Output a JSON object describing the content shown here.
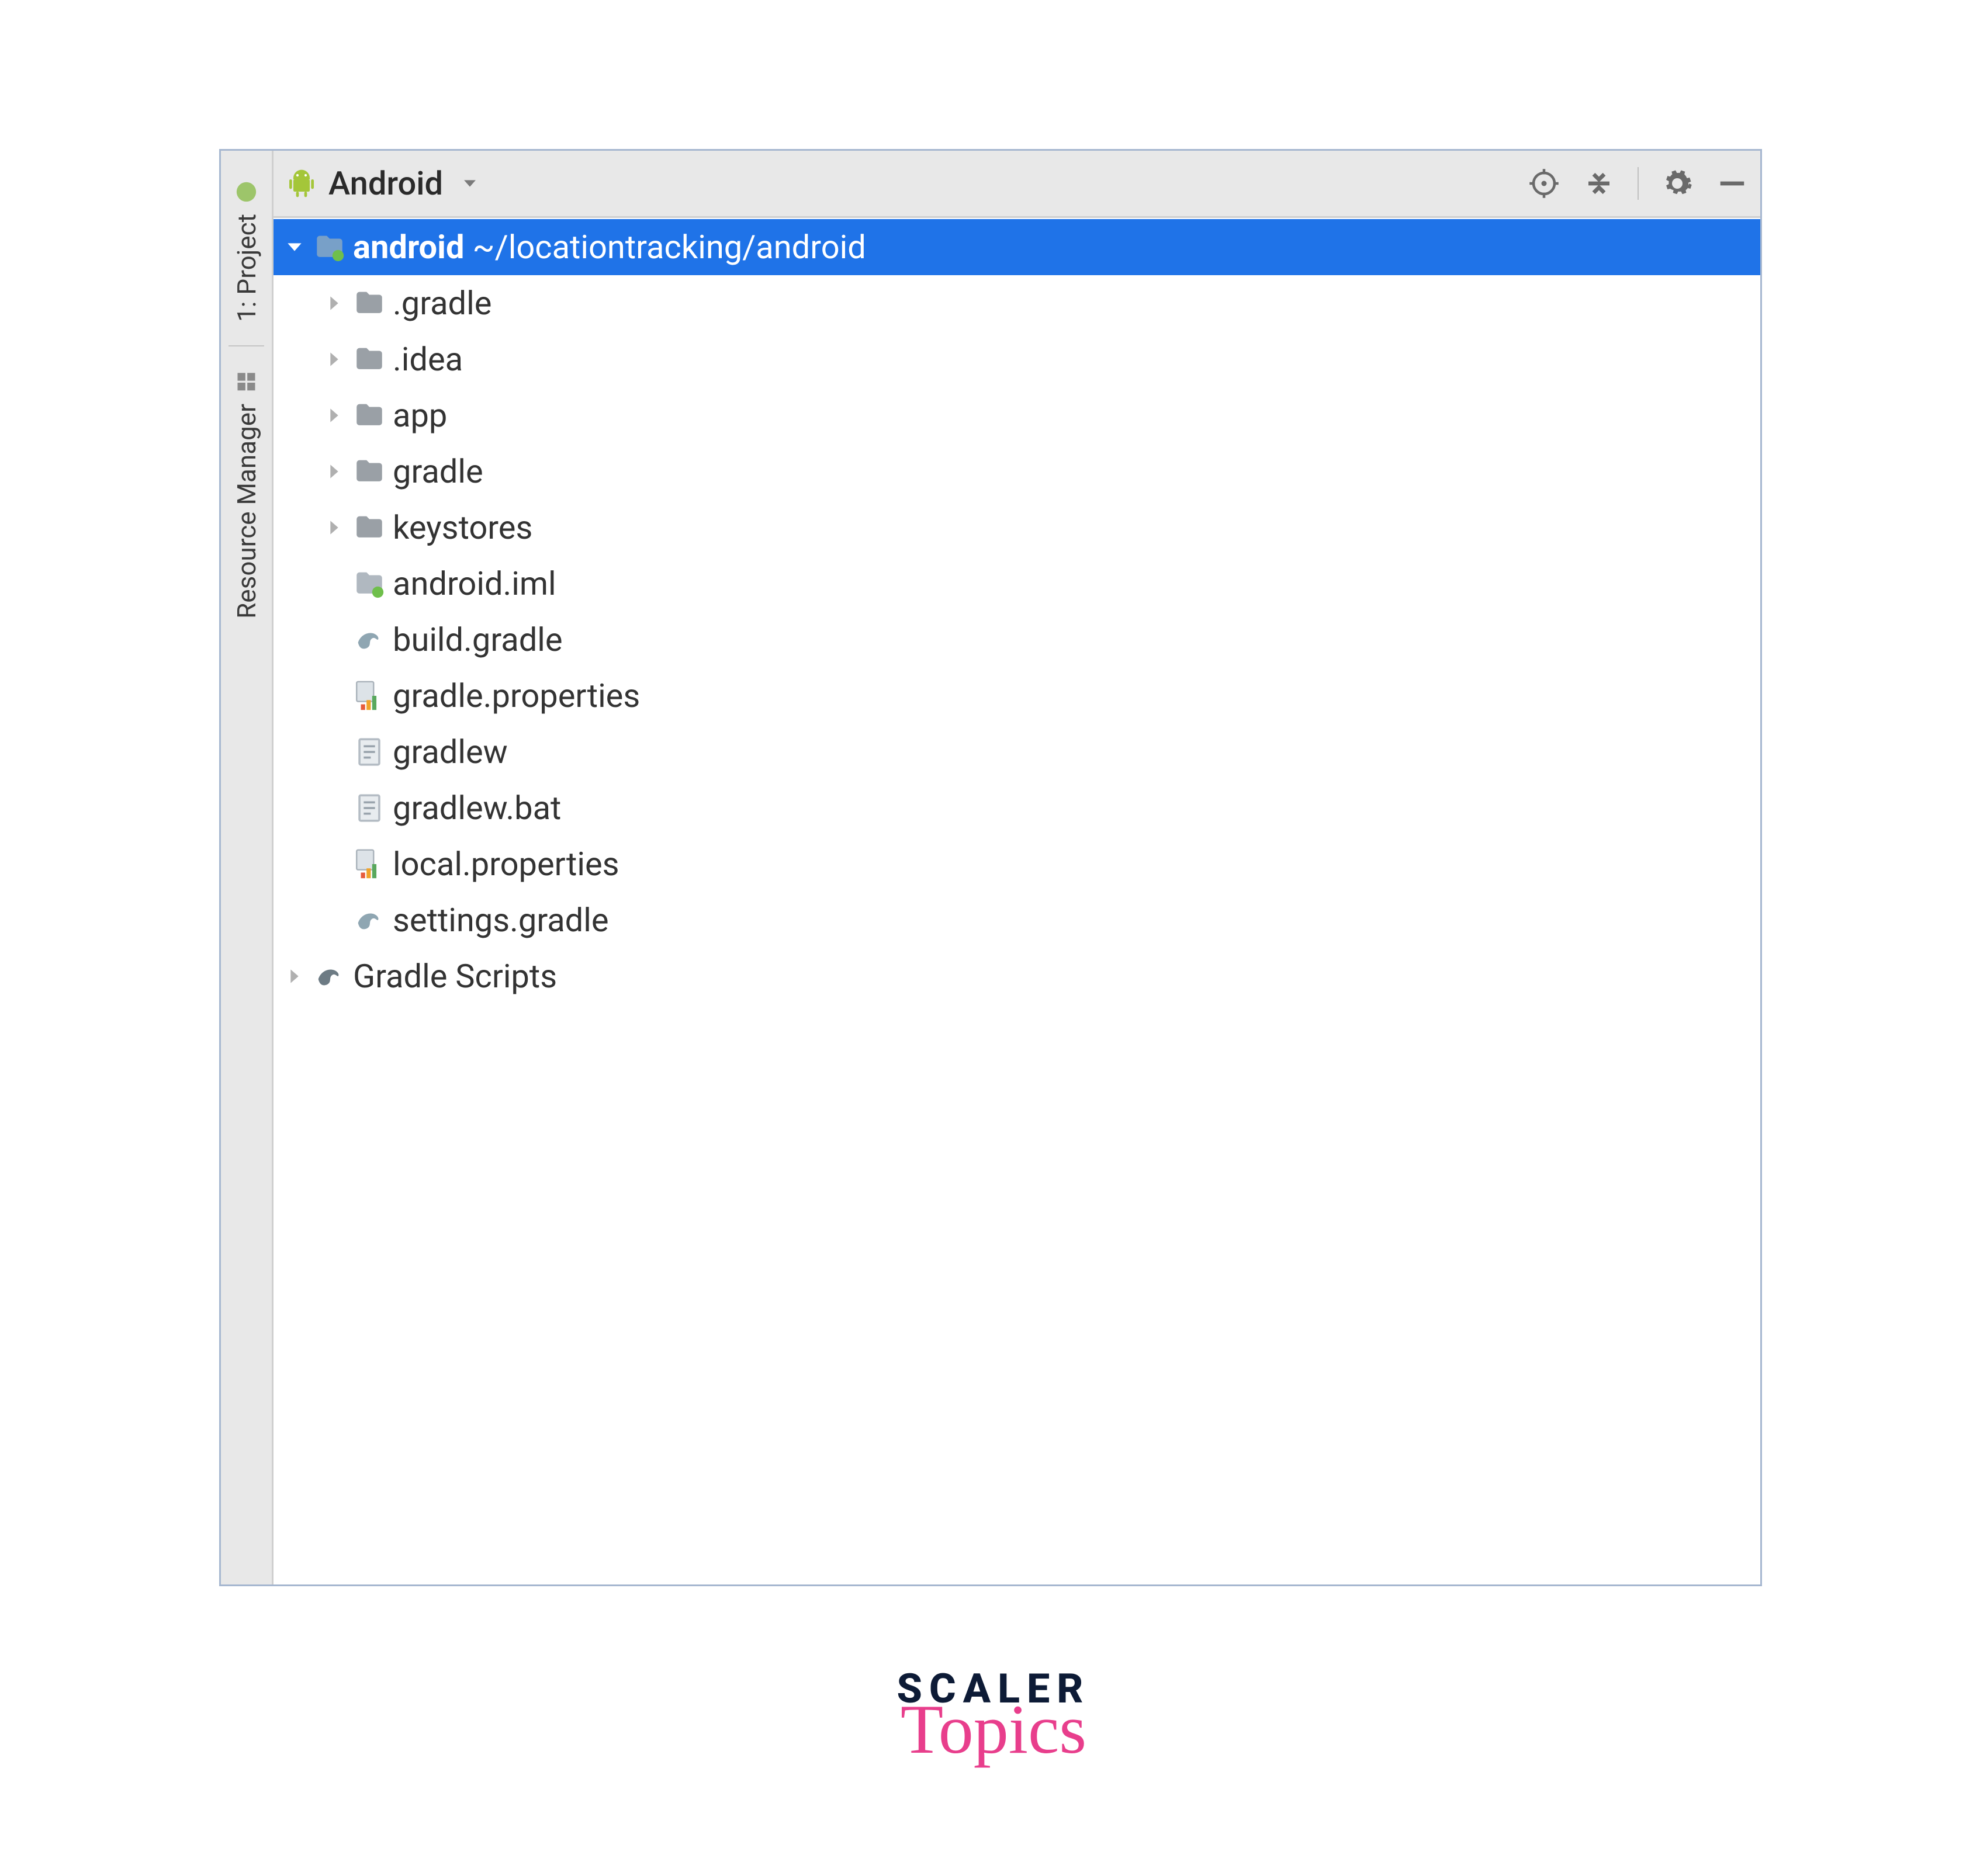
{
  "header": {
    "view_label": "Android"
  },
  "sidebar": {
    "project_label": "1: Project",
    "resource_label": "Resource Manager"
  },
  "tree": {
    "root": {
      "name": "android",
      "path": "~/locationtracking/android"
    },
    "folders": [
      ".gradle",
      ".idea",
      "app",
      "gradle",
      "keystores"
    ],
    "files": [
      {
        "name": "android.iml",
        "icon": "module"
      },
      {
        "name": "build.gradle",
        "icon": "gradle"
      },
      {
        "name": "gradle.properties",
        "icon": "props"
      },
      {
        "name": "gradlew",
        "icon": "text"
      },
      {
        "name": "gradlew.bat",
        "icon": "text"
      },
      {
        "name": "local.properties",
        "icon": "props"
      },
      {
        "name": "settings.gradle",
        "icon": "gradle"
      }
    ],
    "scripts": "Gradle Scripts"
  },
  "watermark": {
    "line1": "SCALER",
    "line2": "Topics"
  }
}
